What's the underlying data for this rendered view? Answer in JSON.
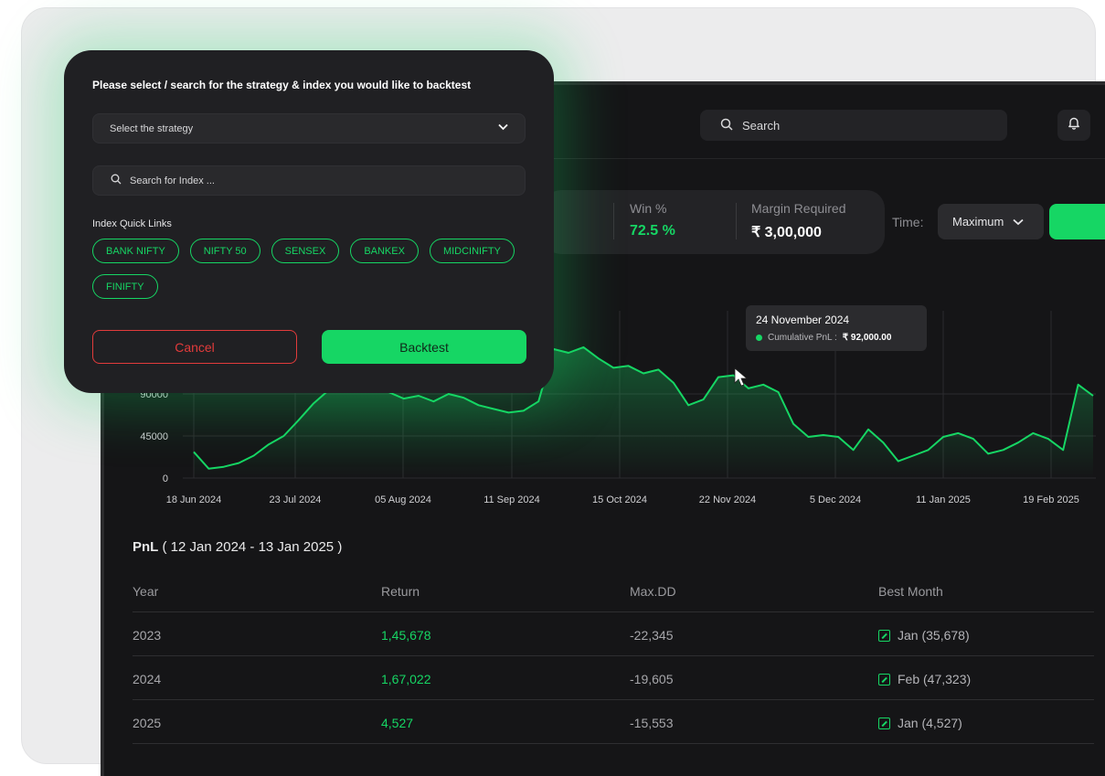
{
  "topbar": {
    "search_label": "Search"
  },
  "stats": {
    "win": {
      "label": "Win %",
      "value": "72.5 %"
    },
    "margin": {
      "label": "Margin Required",
      "value": "₹ 3,00,000"
    }
  },
  "time_filter": {
    "label": "Time:",
    "selected": "Maximum"
  },
  "chart_data": {
    "type": "area",
    "title": "",
    "xlabel": "",
    "ylabel": "",
    "x_ticks": [
      "18 Jun 2024",
      "23 Jul 2024",
      "05 Aug 2024",
      "11 Sep 2024",
      "15 Oct 2024",
      "22 Nov 2024",
      "5 Dec 2024",
      "11 Jan 2025",
      "19 Feb 2025"
    ],
    "y_ticks": [
      0,
      45000,
      90000
    ],
    "ylim": [
      0,
      180000
    ],
    "series": [
      {
        "values": [
          28000,
          10000,
          12000,
          16000,
          24000,
          36000,
          45000,
          62000,
          80000,
          94000,
          98000,
          100000,
          96000,
          92000,
          85000,
          88000,
          82000,
          90000,
          86000,
          78000,
          74000,
          70000,
          72000,
          82000,
          138000,
          134000,
          140000,
          128000,
          118000,
          120000,
          112000,
          116000,
          102000,
          78000,
          84000,
          108000,
          110000,
          96000,
          100000,
          92000,
          58000,
          44000,
          46000,
          44000,
          30000,
          52000,
          38000,
          18000,
          24000,
          30000,
          44000,
          48000,
          42000,
          26000,
          30000,
          38000,
          48000,
          42000,
          30000,
          100000,
          88000
        ]
      }
    ],
    "tooltip": {
      "date": "24 November 2024",
      "label": "Cumulative PnL :",
      "value": "₹ 92,000.00"
    },
    "grid": true,
    "line_color": "#16d664"
  },
  "pnl": {
    "title_bold": "PnL",
    "title_range": " ( 12 Jan 2024 - 13 Jan 2025 )",
    "columns": [
      "Year",
      "Return",
      "Max.DD",
      "Best Month"
    ],
    "rows": [
      {
        "year": "2023",
        "return": "1,45,678",
        "maxdd": "-22,345",
        "best": "Jan (35,678)"
      },
      {
        "year": "2024",
        "return": "1,67,022",
        "maxdd": "-19,605",
        "best": "Feb (47,323)"
      },
      {
        "year": "2025",
        "return": "4,527",
        "maxdd": "-15,553",
        "best": "Jan (4,527)"
      }
    ]
  },
  "modal": {
    "title": "Please select / search for the strategy & index you would like to backtest",
    "strategy_placeholder": "Select the strategy",
    "index_search_placeholder": "Search for Index ...",
    "quick_links_label": "Index Quick Links",
    "quick_links": [
      "BANK NIFTY",
      "NIFTY 50",
      "SENSEX",
      "BANKEX",
      "MIDCINIFTY",
      "FINIFTY"
    ],
    "cancel_label": "Cancel",
    "backtest_label": "Backtest"
  },
  "colors": {
    "accent": "#16d664",
    "danger": "#e23b3b",
    "background": "#151517"
  }
}
